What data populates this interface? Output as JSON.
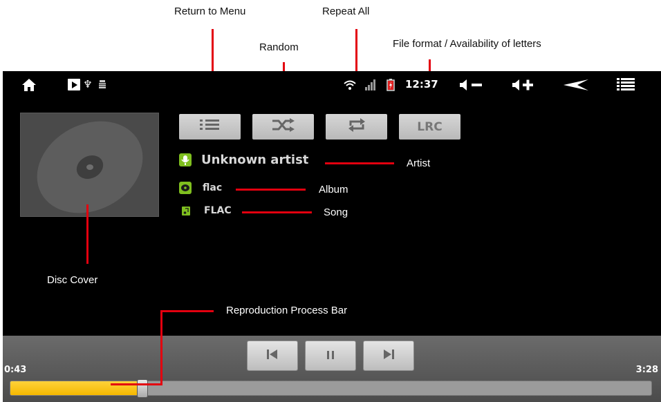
{
  "callouts": {
    "return_to_menu": "Return to Menu",
    "repeat_all": "Repeat All",
    "random": "Random",
    "file_format": "File format / Availability of letters",
    "artist": "Artist",
    "album": "Album",
    "song": "Song",
    "disc_cover": "Disc Cover",
    "process_bar": "Reproduction Process Bar"
  },
  "status_bar": {
    "time": "12:37",
    "icons": [
      "home-icon",
      "media-play-icon",
      "usb-icon",
      "android-debug-icon",
      "wifi-icon",
      "signal-icon",
      "battery-charging-icon",
      "volume-down-icon",
      "volume-up-icon",
      "back-icon",
      "menu-icon"
    ]
  },
  "controls": {
    "lrc_label": "LRC",
    "icons": [
      "list-menu-icon",
      "shuffle-icon",
      "repeat-icon"
    ]
  },
  "track": {
    "artist": "Unknown artist",
    "album": "flac",
    "song": "FLAC"
  },
  "playback": {
    "elapsed": "0:43",
    "total": "3:28",
    "progress": 0.2067
  },
  "colors": {
    "callout_line": "#e3000f",
    "progress_fill": "#f5b800",
    "accent_green": "#7fbf1f"
  }
}
